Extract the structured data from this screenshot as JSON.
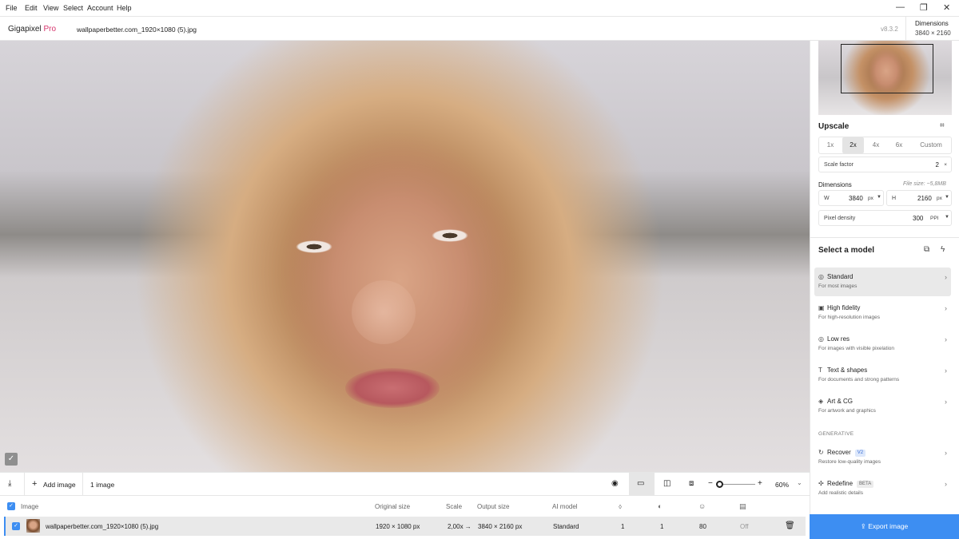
{
  "menu": [
    "File",
    "Edit",
    "View",
    "Select",
    "Account",
    "Help"
  ],
  "window_controls": {
    "minimize": "—",
    "maximize": "❐",
    "close": "✕"
  },
  "app": {
    "name": "Gigapixel",
    "edition": "Pro",
    "file_name": "wallpaperbetter.com_1920×1080 (5).jpg",
    "version": "v8.3.2"
  },
  "dimensions_header": {
    "title": "Dimensions",
    "value": "3840 × 2160"
  },
  "preview": {
    "done_icon": "✓"
  },
  "upscale": {
    "title": "Upscale",
    "scales": [
      "1x",
      "2x",
      "4x",
      "6x",
      "Custom"
    ],
    "active_scale": "2x",
    "scale_factor_label": "Scale factor",
    "scale_factor_value": "2",
    "scale_factor_unit": "×",
    "dimensions_label": "Dimensions",
    "file_size": "File size: ~5,8MB",
    "width_label": "W",
    "width_value": "3840",
    "width_unit": "px",
    "height_label": "H",
    "height_value": "2160",
    "height_unit": "px",
    "density_label": "Pixel density",
    "density_value": "300",
    "density_unit": "PPI"
  },
  "models": {
    "title": "Select a model",
    "items": [
      {
        "name": "Standard",
        "desc": "For most images",
        "icon": "◎"
      },
      {
        "name": "High fidelity",
        "desc": "For high-resolution images",
        "icon": "▣"
      },
      {
        "name": "Low res",
        "desc": "For images with visible pixelation",
        "icon": "◎"
      },
      {
        "name": "Text & shapes",
        "desc": "For documents and strong patterns",
        "icon": "T"
      },
      {
        "name": "Art & CG",
        "desc": "For artwork and graphics",
        "icon": "◈"
      }
    ],
    "generative_label": "GENERATIVE",
    "generative": [
      {
        "name": "Recover",
        "badge": "V2",
        "desc": "Restore low-quality images",
        "icon": "↻"
      },
      {
        "name": "Redefine",
        "badge": "BETA",
        "desc": "Add realistic details",
        "icon": "✣"
      }
    ]
  },
  "toolbar": {
    "add_image": "Add image",
    "add_icon": "+",
    "count": "1 image",
    "zoom": "60%",
    "zoom_minus": "−",
    "zoom_plus": "+"
  },
  "table": {
    "headers": {
      "image": "Image",
      "original": "Original size",
      "scale": "Scale",
      "output": "Output size",
      "model": "AI model"
    },
    "row": {
      "name": "wallpaperbetter.com_1920×1080 (5).jpg",
      "original": "1920 × 1080 px",
      "scale": "2,00x →",
      "output": "3840 × 2160 px",
      "model": "Standard",
      "c1": "1",
      "c2": "1",
      "c3": "80",
      "c4": "Off"
    }
  },
  "export": {
    "label": "Export image",
    "icon": "⇪"
  },
  "colors": {
    "accent": "#3d8ef2",
    "brand_pro": "#d6336c"
  }
}
